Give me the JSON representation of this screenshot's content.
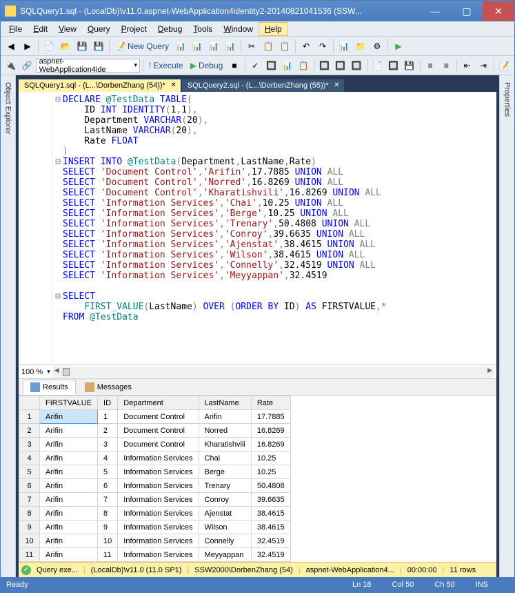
{
  "title": "SQLQuery1.sql - (LocalDb)\\v11.0.aspnet-WebApplication4identity2-20140821041536 (SSW...",
  "menu": [
    "File",
    "Edit",
    "View",
    "Query",
    "Project",
    "Debug",
    "Tools",
    "Window",
    "Help"
  ],
  "newQuery": "New Query",
  "dbDropdown": "aspnet-WebApplication4ide",
  "execute": "Execute",
  "debug": "Debug",
  "sidebarLeft": "Object Explorer",
  "sidebarRight": "Properties",
  "tabs": [
    {
      "label": "SQLQuery1.sql - (L...\\DorbenZhang (54))*",
      "active": true
    },
    {
      "label": "SQLQuery2.sql - (L...\\DorbenZhang (55))*",
      "active": false
    }
  ],
  "zoom": "100 %",
  "resultTabs": {
    "results": "Results",
    "messages": "Messages"
  },
  "grid": {
    "headers": [
      "",
      "FIRSTVALUE",
      "ID",
      "Department",
      "LastName",
      "Rate"
    ],
    "rows": [
      [
        "1",
        "Arifin",
        "1",
        "Document Control",
        "Arifin",
        "17.7885"
      ],
      [
        "2",
        "Arifin",
        "2",
        "Document Control",
        "Norred",
        "16.8269"
      ],
      [
        "3",
        "Arifin",
        "3",
        "Document Control",
        "Kharatishvili",
        "16.8269"
      ],
      [
        "4",
        "Arifin",
        "4",
        "Information Services",
        "Chai",
        "10.25"
      ],
      [
        "5",
        "Arifin",
        "5",
        "Information Services",
        "Berge",
        "10.25"
      ],
      [
        "6",
        "Arifin",
        "6",
        "Information Services",
        "Trenary",
        "50.4808"
      ],
      [
        "7",
        "Arifin",
        "7",
        "Information Services",
        "Conroy",
        "39.6635"
      ],
      [
        "8",
        "Arifin",
        "8",
        "Information Services",
        "Ajenstat",
        "38.4615"
      ],
      [
        "9",
        "Arifin",
        "9",
        "Information Services",
        "Wilson",
        "38.4615"
      ],
      [
        "10",
        "Arifin",
        "10",
        "Information Services",
        "Connelly",
        "32.4519"
      ],
      [
        "11",
        "Arifin",
        "11",
        "Information Services",
        "Meyyappan",
        "32.4519"
      ]
    ]
  },
  "qstatus": {
    "state": "Query exe...",
    "server": "(LocalDb)\\v11.0 (11.0 SP1)",
    "user": "SSW2000\\DorbenZhang (54)",
    "db": "aspnet-WebApplication4...",
    "time": "00:00:00",
    "rows": "11 rows"
  },
  "status": {
    "ready": "Ready",
    "ln": "Ln 18",
    "col": "Col 50",
    "ch": "Ch 50",
    "ins": "INS"
  },
  "chart_data": {
    "type": "table",
    "title": "FIRST_VALUE over @TestData",
    "columns": [
      "FIRSTVALUE",
      "ID",
      "Department",
      "LastName",
      "Rate"
    ],
    "rows": [
      [
        "Arifin",
        1,
        "Document Control",
        "Arifin",
        17.7885
      ],
      [
        "Arifin",
        2,
        "Document Control",
        "Norred",
        16.8269
      ],
      [
        "Arifin",
        3,
        "Document Control",
        "Kharatishvili",
        16.8269
      ],
      [
        "Arifin",
        4,
        "Information Services",
        "Chai",
        10.25
      ],
      [
        "Arifin",
        5,
        "Information Services",
        "Berge",
        10.25
      ],
      [
        "Arifin",
        6,
        "Information Services",
        "Trenary",
        50.4808
      ],
      [
        "Arifin",
        7,
        "Information Services",
        "Conroy",
        39.6635
      ],
      [
        "Arifin",
        8,
        "Information Services",
        "Ajenstat",
        38.4615
      ],
      [
        "Arifin",
        9,
        "Information Services",
        "Wilson",
        38.4615
      ],
      [
        "Arifin",
        10,
        "Information Services",
        "Connelly",
        32.4519
      ],
      [
        "Arifin",
        11,
        "Information Services",
        "Meyyappan",
        32.4519
      ]
    ]
  }
}
